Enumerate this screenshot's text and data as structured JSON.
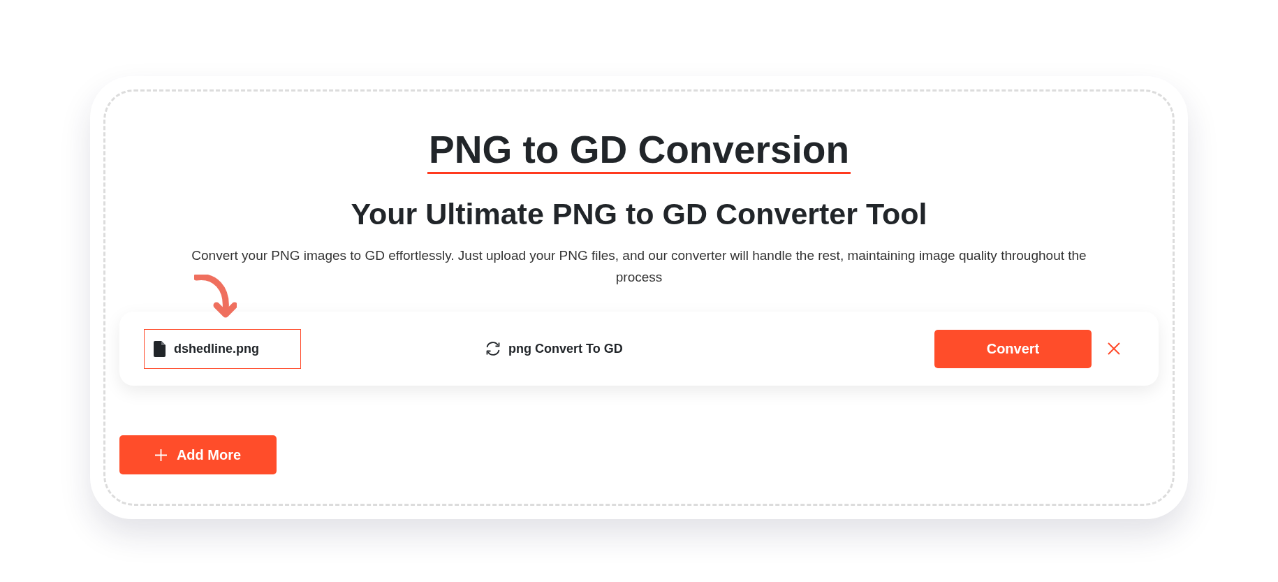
{
  "heading": {
    "title": "PNG to GD Conversion",
    "subtitle": "Your Ultimate PNG to GD Converter Tool",
    "description": "Convert your PNG images to GD effortlessly. Just upload your PNG files, and our converter will handle the rest, maintaining image quality throughout the process"
  },
  "files": [
    {
      "name": "dshedline.png",
      "conversion": "png Convert To GD",
      "button": "Convert"
    }
  ],
  "add_more": {
    "label": "Add More"
  }
}
